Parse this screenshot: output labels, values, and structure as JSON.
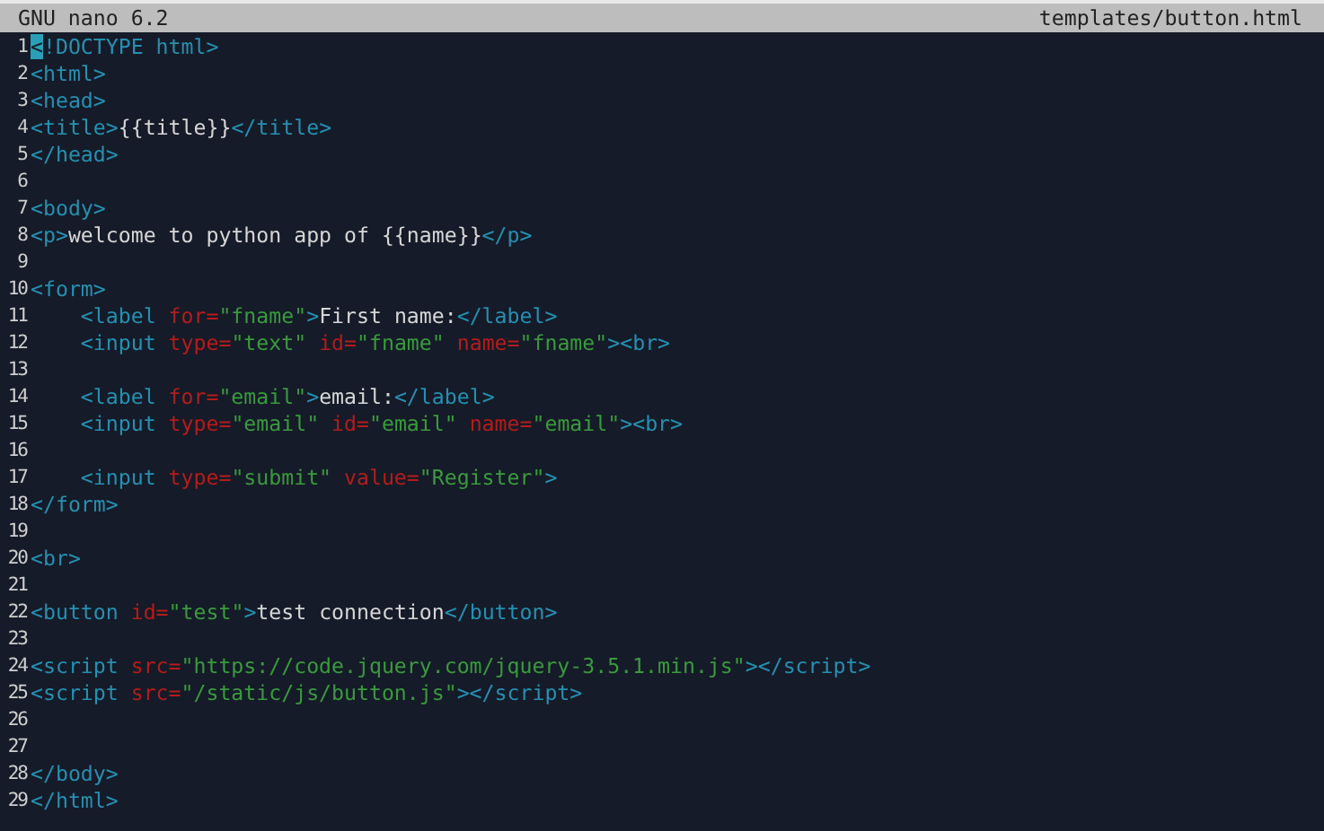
{
  "title_bar": {
    "app": "GNU nano 6.2",
    "file": "templates/button.html"
  },
  "lines": [
    {
      "number": "1",
      "tokens": [
        {
          "kind": "cursor",
          "text": "<"
        },
        {
          "kind": "tag",
          "text": "!DOCTYPE html>"
        }
      ]
    },
    {
      "number": "2",
      "tokens": [
        {
          "kind": "tag",
          "text": "<html>"
        }
      ]
    },
    {
      "number": "3",
      "tokens": [
        {
          "kind": "tag",
          "text": "<head>"
        }
      ]
    },
    {
      "number": "4",
      "tokens": [
        {
          "kind": "tag",
          "text": "<title>"
        },
        {
          "kind": "text",
          "text": "{{title}}"
        },
        {
          "kind": "tag",
          "text": "</title>"
        }
      ]
    },
    {
      "number": "5",
      "tokens": [
        {
          "kind": "tag",
          "text": "</head>"
        }
      ]
    },
    {
      "number": "6"
    },
    {
      "number": "7",
      "tokens": [
        {
          "kind": "tag",
          "text": "<body>"
        }
      ]
    },
    {
      "number": "8",
      "tokens": [
        {
          "kind": "tag",
          "text": "<p>"
        },
        {
          "kind": "text",
          "text": "welcome to python app of {{name}}"
        },
        {
          "kind": "tag",
          "text": "</p>"
        }
      ]
    },
    {
      "number": "9"
    },
    {
      "number": "10",
      "tokens": [
        {
          "kind": "tag",
          "text": "<form>"
        }
      ]
    },
    {
      "number": "11",
      "tokens": [
        {
          "kind": "tag",
          "text": "    <label "
        },
        {
          "kind": "attr",
          "text": "for="
        },
        {
          "kind": "string",
          "text": "\"fname\""
        },
        {
          "kind": "tag",
          "text": ">"
        },
        {
          "kind": "text",
          "text": "First name:"
        },
        {
          "kind": "tag",
          "text": "</label>"
        }
      ]
    },
    {
      "number": "12",
      "tokens": [
        {
          "kind": "tag",
          "text": "    <input "
        },
        {
          "kind": "attr",
          "text": "type="
        },
        {
          "kind": "string",
          "text": "\"text\" "
        },
        {
          "kind": "attr",
          "text": "id="
        },
        {
          "kind": "string",
          "text": "\"fname\" "
        },
        {
          "kind": "attr",
          "text": "name="
        },
        {
          "kind": "string",
          "text": "\"fname\""
        },
        {
          "kind": "tag",
          "text": "><br>"
        }
      ]
    },
    {
      "number": "13"
    },
    {
      "number": "14",
      "tokens": [
        {
          "kind": "tag",
          "text": "    <label "
        },
        {
          "kind": "attr",
          "text": "for="
        },
        {
          "kind": "string",
          "text": "\"email\""
        },
        {
          "kind": "tag",
          "text": ">"
        },
        {
          "kind": "text",
          "text": "email:"
        },
        {
          "kind": "tag",
          "text": "</label>"
        }
      ]
    },
    {
      "number": "15",
      "tokens": [
        {
          "kind": "tag",
          "text": "    <input "
        },
        {
          "kind": "attr",
          "text": "type="
        },
        {
          "kind": "string",
          "text": "\"email\" "
        },
        {
          "kind": "attr",
          "text": "id="
        },
        {
          "kind": "string",
          "text": "\"email\" "
        },
        {
          "kind": "attr",
          "text": "name="
        },
        {
          "kind": "string",
          "text": "\"email\""
        },
        {
          "kind": "tag",
          "text": "><br>"
        }
      ]
    },
    {
      "number": "16"
    },
    {
      "number": "17",
      "tokens": [
        {
          "kind": "tag",
          "text": "    <input "
        },
        {
          "kind": "attr",
          "text": "type="
        },
        {
          "kind": "string",
          "text": "\"submit\" "
        },
        {
          "kind": "attr",
          "text": "value="
        },
        {
          "kind": "string",
          "text": "\"Register\""
        },
        {
          "kind": "tag",
          "text": ">"
        }
      ]
    },
    {
      "number": "18",
      "tokens": [
        {
          "kind": "tag",
          "text": "</form>"
        }
      ]
    },
    {
      "number": "19"
    },
    {
      "number": "20",
      "tokens": [
        {
          "kind": "tag",
          "text": "<br>"
        }
      ]
    },
    {
      "number": "21"
    },
    {
      "number": "22",
      "tokens": [
        {
          "kind": "tag",
          "text": "<button "
        },
        {
          "kind": "attr",
          "text": "id="
        },
        {
          "kind": "string",
          "text": "\"test\""
        },
        {
          "kind": "tag",
          "text": ">"
        },
        {
          "kind": "text",
          "text": "test connection"
        },
        {
          "kind": "tag",
          "text": "</button>"
        }
      ]
    },
    {
      "number": "23"
    },
    {
      "number": "24",
      "tokens": [
        {
          "kind": "tag",
          "text": "<script "
        },
        {
          "kind": "attr",
          "text": "src="
        },
        {
          "kind": "string",
          "text": "\"https://code.jquery.com/jquery-3.5.1.min.js\""
        },
        {
          "kind": "tag",
          "text": "></script>"
        }
      ]
    },
    {
      "number": "25",
      "tokens": [
        {
          "kind": "tag",
          "text": "<script "
        },
        {
          "kind": "attr",
          "text": "src="
        },
        {
          "kind": "string",
          "text": "\"/static/js/button.js\""
        },
        {
          "kind": "tag",
          "text": "></script>"
        }
      ]
    },
    {
      "number": "26"
    },
    {
      "number": "27"
    },
    {
      "number": "28",
      "tokens": [
        {
          "kind": "tag",
          "text": "</body>"
        }
      ]
    },
    {
      "number": "29",
      "tokens": [
        {
          "kind": "tag",
          "text": "</html>"
        }
      ]
    }
  ]
}
